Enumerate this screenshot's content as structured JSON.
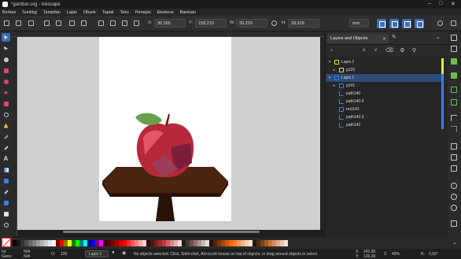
{
  "window": {
    "title": "*gambar.svg - Inkscape"
  },
  "menu": [
    "Berkas",
    "Sunting",
    "Tampilan",
    "Lapis",
    "Obyek",
    "Tapak",
    "Teks",
    "Penapis",
    "Ekstensi",
    "Bantuan"
  ],
  "toolbar": {
    "x_label": "X:",
    "x_value": "30,365",
    "y_label": "Y:",
    "y_value": "158,210",
    "w_label": "W:",
    "w_value": "30,220",
    "h_label": "H:",
    "h_value": "39,918",
    "unit": "mm"
  },
  "panel": {
    "tab_label": "Layers and Objects",
    "items": [
      {
        "label": "Lapis 2",
        "type": "layer",
        "expanded": true,
        "selected": false
      },
      {
        "label": "g120",
        "type": "group",
        "expanded": false,
        "selected": false
      },
      {
        "label": "Lapis 1",
        "type": "layer",
        "expanded": true,
        "selected": true
      },
      {
        "label": "g141",
        "type": "group",
        "expanded": false,
        "selected": false
      },
      {
        "label": "path140",
        "type": "path",
        "selected": false
      },
      {
        "label": "path140-9",
        "type": "path",
        "selected": false
      },
      {
        "label": "rect141",
        "type": "rect",
        "selected": false
      },
      {
        "label": "path142-3",
        "type": "path",
        "selected": false
      },
      {
        "label": "path142",
        "type": "path",
        "selected": false
      }
    ]
  },
  "status": {
    "fill_label": "Isi:",
    "fill_value": "N/A",
    "stroke_label": "Garis:",
    "stroke_value": "N/A",
    "opacity_label": "O:",
    "opacity_value": "100",
    "layer": "Lapis 1",
    "message": "No objects selected. Click, Shift+click, Alt+scroll mouse on top of objects, or drag around objects to select.",
    "x_label": "X:",
    "x_value": "242,90",
    "y_label": "Y:",
    "y_value": "126,39",
    "zoom_label": "Z:",
    "zoom_value": "49%",
    "rotation_label": "R:",
    "rotation_value": "0,00°"
  },
  "colors": {
    "accent": "#3c6fb6",
    "layer_marker_yellow": "#e8e83a",
    "layer_marker_blue": "#3a7fe8",
    "selection": "#2c4c78"
  },
  "palette": [
    "#000000",
    "#1a1a1a",
    "#333333",
    "#4d4d4d",
    "#666666",
    "#808080",
    "#999999",
    "#b3b3b3",
    "#cccccc",
    "#e6e6e6",
    "#ffffff",
    "#800000",
    "#ff0000",
    "#808000",
    "#ffff00",
    "#008000",
    "#00ff00",
    "#008080",
    "#00ffff",
    "#000080",
    "#0000ff",
    "#800080",
    "#ff00ff",
    "#2b0000",
    "#550000",
    "#800000",
    "#aa0000",
    "#d40000",
    "#ff0000",
    "#ff2a2a",
    "#ff5555",
    "#ff8080",
    "#ffaaaa",
    "#ffd5d5",
    "#280b0b",
    "#501616",
    "#782121",
    "#a02c2c",
    "#c83737",
    "#d35f5f",
    "#de8787",
    "#e9afaf",
    "#f4d7d7",
    "#241c1c",
    "#483737",
    "#6c5353",
    "#916f6f",
    "#ac9393",
    "#c8b7b7",
    "#e3dbdb",
    "#2b1100",
    "#552200",
    "#803300",
    "#aa4400",
    "#d45500",
    "#ff6600",
    "#ff7f2a",
    "#ff9955",
    "#ffb380",
    "#ffccaa",
    "#ffe6d5",
    "#28170b",
    "#502d16",
    "#784421",
    "#a05a2c",
    "#c87137",
    "#d38d5f",
    "#deaa87",
    "#e9c6af",
    "#f4e3d7"
  ]
}
